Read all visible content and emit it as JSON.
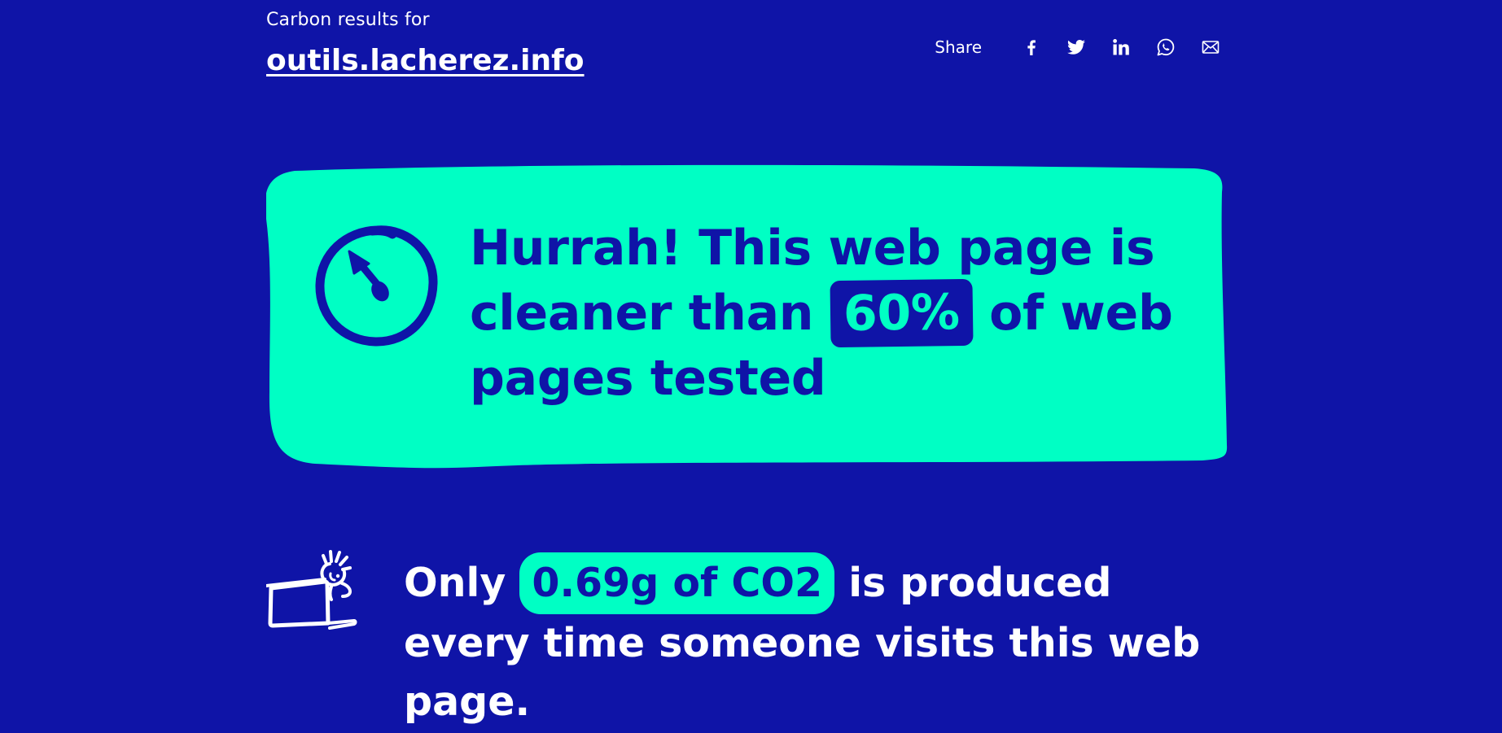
{
  "header": {
    "results_for": "Carbon results for",
    "site": "outils.lacherez.info"
  },
  "share": {
    "label": "Share",
    "buttons": [
      {
        "icon": "facebook-icon"
      },
      {
        "icon": "twitter-icon"
      },
      {
        "icon": "linkedin-icon"
      },
      {
        "icon": "whatsapp-icon"
      },
      {
        "icon": "email-icon"
      }
    ]
  },
  "hero": {
    "line_before": "Hurrah! This web page is cleaner than",
    "percent": "60%",
    "line_after": "of web pages tested",
    "icon": "stopwatch-icon"
  },
  "co2": {
    "before": "Only",
    "amount": "0.69g of CO2",
    "after": "is produced every time someone visits this web page.",
    "icon": "person-with-laptop-icon"
  },
  "colors": {
    "background": "#0f14a7",
    "accent": "#00ffc4",
    "text": "#ffffff"
  }
}
